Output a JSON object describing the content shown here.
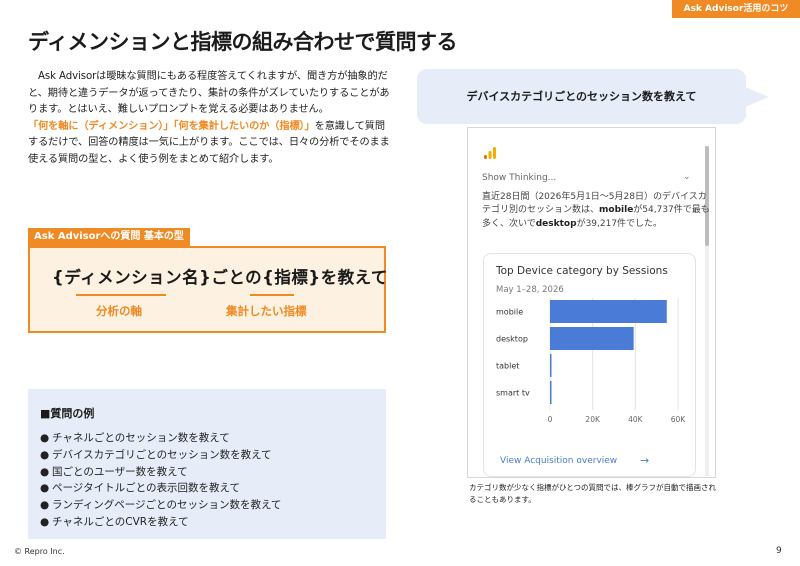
{
  "header": {
    "tag": "Ask Advisor活用のコツ",
    "title": "ディメンションと指標の組み合わせで質問する"
  },
  "intro": {
    "p1": "Ask Advisorは曖昧な質問にもある程度答えてくれますが、聞き方が抽象的だと、期待と違うデータが返ってきたり、集計の条件がズレていたりすることがあります。とはいえ、難しいプロンプトを覚える必要はありません。",
    "highlight": "「何を軸に（ディメンション）」「何を集計したいのか（指標）」",
    "p2": "を意識して質問するだけで、回答の精度は一気に上がります。ここでは、日々の分析でそのまま使える質問の型と、よく使う例をまとめて紹介します。"
  },
  "formula": {
    "label": "Ask Advisorへの質問 基本の型",
    "text": "{ディメンション名}ごとの{指標}を教えて",
    "sub_left": "分析の軸",
    "sub_right": "集計したい指標"
  },
  "examples": {
    "heading": "■質問の例",
    "bullet": "●",
    "items": [
      "チャネルごとのセッション数を教えて",
      "デバイスカテゴリごとのセッション数を教えて",
      "国ごとのユーザー数を教えて",
      "ページタイトルごとの表示回数を教えて",
      "ランディングページごとのセッション数を教えて",
      "チャネルごとのCVRを教えて"
    ]
  },
  "bubble": {
    "text": "デバイスカテゴリごとのセッション数を教えて"
  },
  "screenshot": {
    "thinking": "Show Thinking...",
    "chevron": "⌄",
    "answer_a": "直近28日間（2026年5月1日～5月28日）のデバイスカテゴリ別のセッション数は、",
    "answer_b1": "mobile",
    "answer_c": "が54,737件で最も多く、次いで",
    "answer_b2": "desktop",
    "answer_d": "が39,217件でした。",
    "card_title": "Top Device category by Sessions",
    "card_date": "May 1–28, 2026",
    "link": "View Acquisition overview",
    "link_arrow": "→"
  },
  "chart_data": {
    "type": "bar",
    "orientation": "horizontal",
    "title": "Top Device category by Sessions",
    "subtitle": "May 1–28, 2026",
    "categories": [
      "mobile",
      "desktop",
      "tablet",
      "smart tv"
    ],
    "values": [
      54737,
      39217,
      250,
      120
    ],
    "xlim": [
      0,
      60000
    ],
    "xticks": [
      "0",
      "20K",
      "40K",
      "60K"
    ],
    "grid": true,
    "bar_color": "#4a7bd6"
  },
  "caption": "カテゴリ数が少なく指標がひとつの質問では、棒グラフが自動で描画されることもあります。",
  "footer": {
    "copyright": "© Repro Inc.",
    "page": "9"
  }
}
